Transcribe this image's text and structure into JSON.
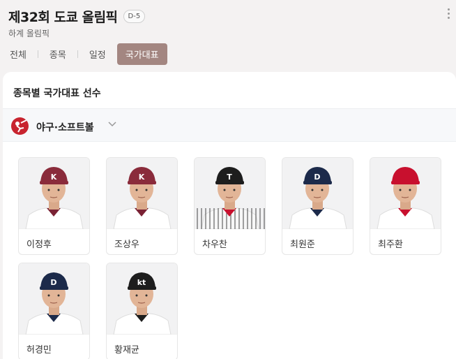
{
  "header": {
    "title": "제32회 도쿄 올림픽",
    "dday": "D-5",
    "subtitle": "하계 올림픽",
    "tabs": [
      {
        "label": "전체"
      },
      {
        "label": "종목"
      },
      {
        "label": "일정"
      },
      {
        "label": "국가대표",
        "active": true
      }
    ]
  },
  "panel": {
    "title": "종목별 국가대표 선수",
    "sport": {
      "name": "야구·소프트볼",
      "icon": "baseball-icon"
    }
  },
  "players": [
    {
      "name": "이정후",
      "cap": "#8a2b3b",
      "capText": "K",
      "jersey": "#ffffff",
      "trim": "#7a2234"
    },
    {
      "name": "조상우",
      "cap": "#8a2b3b",
      "capText": "K",
      "jersey": "#ffffff",
      "trim": "#7a2234"
    },
    {
      "name": "차우찬",
      "cap": "#1d1d1d",
      "capText": "T",
      "jersey": "pinstripe",
      "trim": "#c8102e"
    },
    {
      "name": "최원준",
      "cap": "#1c2a4a",
      "capText": "D",
      "jersey": "#ffffff",
      "trim": "#1c2a4a"
    },
    {
      "name": "최주환",
      "cap": "#c8102e",
      "capText": "",
      "jersey": "#ffffff",
      "trim": "#c8102e"
    },
    {
      "name": "허경민",
      "cap": "#1c2a4a",
      "capText": "D",
      "jersey": "#ffffff",
      "trim": "#1c2a4a"
    },
    {
      "name": "황재균",
      "cap": "#1d1d1d",
      "capText": "kt",
      "jersey": "#ffffff",
      "trim": "#1d1d1d"
    }
  ]
}
